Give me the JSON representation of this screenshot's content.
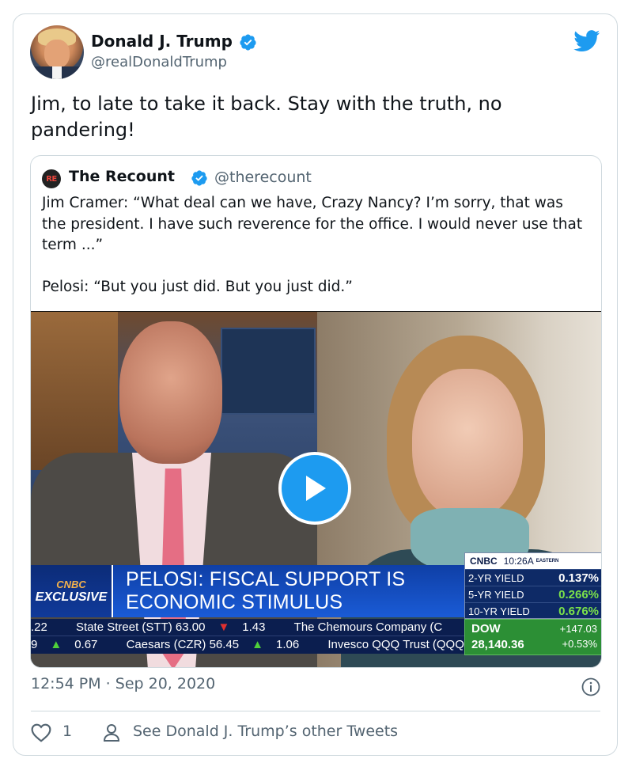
{
  "author": {
    "name": "Donald J. Trump",
    "handle": "@realDonaldTrump"
  },
  "tweet": {
    "text_line1": "Jim, to late to take it back. Stay with the truth, no",
    "text_line2": "pandering!",
    "timestamp": "12:54 PM · Sep 20, 2020",
    "like_count": "1",
    "other_tweets_label": "See Donald J. Trump’s other Tweets"
  },
  "quoted": {
    "avatar_text": "RE",
    "name": "The Recount",
    "handle": "@therecount",
    "paragraph1": "Jim Cramer: “What deal can we have, Crazy Nancy? I’m sorry, that was the president. I have such reverence for the office. I would never use that term ...”",
    "paragraph2": "Pelosi: “But you just did. But you just did.”"
  },
  "video": {
    "tag_brand": "CNBC",
    "tag_label": "EXCLUSIVE",
    "headline_line1": "PELOSI: FISCAL SUPPORT IS",
    "headline_line2": "ECONOMIC STIMULUS",
    "market_header_brand": "CNBC",
    "market_time": "10:26A",
    "market_zone": "EASTERN",
    "yields": [
      {
        "label": "2-YR YIELD",
        "value": "0.137%"
      },
      {
        "label": "5-YR YIELD",
        "value": "0.266%"
      },
      {
        "label": "10-YR YIELD",
        "value": "0.676%"
      }
    ],
    "ticker_row1": [
      {
        "text": ".22"
      },
      {
        "text": "State Street (STT) 63.00",
        "arrow": "▼",
        "change": "1.43"
      },
      {
        "text": "The Chemours Company (C"
      }
    ],
    "ticker_row2": [
      {
        "text": "9",
        "arrow": "▲",
        "change": "0.67"
      },
      {
        "text": "Caesars (CZR) 56.45",
        "arrow": "▲",
        "change": "1.06"
      },
      {
        "text": "Invesco QQQ Trust (QQQ)"
      }
    ],
    "dow": {
      "label": "DOW",
      "value": "28,140.36",
      "change": "+147.03",
      "pct": "+0.53%"
    }
  },
  "colors": {
    "twitter_blue": "#1d9bf0",
    "text_primary": "#0f1419",
    "text_secondary": "#536471",
    "border": "#cfd9de"
  }
}
